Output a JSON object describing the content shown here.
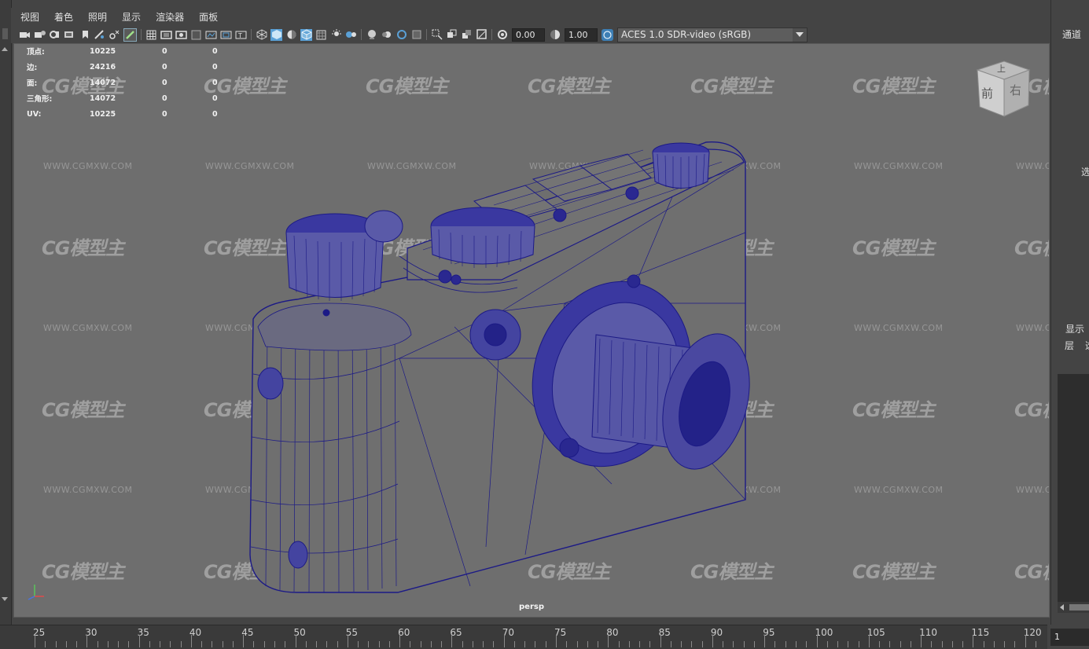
{
  "menu": [
    "视图",
    "着色",
    "照明",
    "显示",
    "渲染器",
    "面板"
  ],
  "toolbar": {
    "icons_left": [
      "camera-select-icon",
      "camera-attributes-icon",
      "bookmark-icon",
      "image-plane-icon",
      "grease-pencil-icon",
      "2d-pan-zoom-icon",
      "grid-icon",
      "film-gate-icon",
      "resolution-gate-icon",
      "gate-mask-icon",
      "field-chart-icon",
      "safe-action-icon",
      "safe-title-icon",
      "wireframe-icon",
      "smooth-shade-icon",
      "default-material-icon",
      "wireframe-on-shaded-icon",
      "xray-icon",
      "use-all-lights-icon",
      "shadows-icon",
      "screen-space-ao-icon",
      "motion-blur-icon",
      "anti-aliasing-icon",
      "depth-of-field-icon",
      "isolate-select-icon",
      "xray-joints-icon",
      "xray-active-icon",
      "backface-cull-icon",
      "exposure-icon"
    ],
    "exposure": "0.00",
    "gamma": "1.00",
    "color_space": "ACES 1.0 SDR-video (sRGB)"
  },
  "hud": [
    {
      "label": "顶点:",
      "value": "10225",
      "a": "0",
      "b": "0"
    },
    {
      "label": "边:",
      "value": "24216",
      "a": "0",
      "b": "0"
    },
    {
      "label": "面:",
      "value": "14072",
      "a": "0",
      "b": "0"
    },
    {
      "label": "三角形:",
      "value": "14072",
      "a": "0",
      "b": "0"
    },
    {
      "label": "UV:",
      "value": "10225",
      "a": "0",
      "b": "0"
    }
  ],
  "viewcube": {
    "top": "上",
    "front": "前",
    "right": "右"
  },
  "camera_name": "persp",
  "watermark": {
    "text": "CG模型主",
    "url": "WWW.CGMXW.COM"
  },
  "right_panel": {
    "channels": "通道",
    "select": "选",
    "display": "显示",
    "layers": "层",
    "layers_more": "选"
  },
  "timeline": {
    "ticks": [
      "25",
      "30",
      "35",
      "40",
      "45",
      "50",
      "55",
      "60",
      "65",
      "70",
      "75",
      "80",
      "85",
      "90",
      "95",
      "100",
      "105",
      "110",
      "115",
      "120"
    ],
    "current_frame": "1"
  },
  "colors": {
    "viewport_bg": "#6e6e6e",
    "wire": "#1c1a86",
    "ui_bg": "#444444",
    "accent": "#5aa0d6"
  }
}
